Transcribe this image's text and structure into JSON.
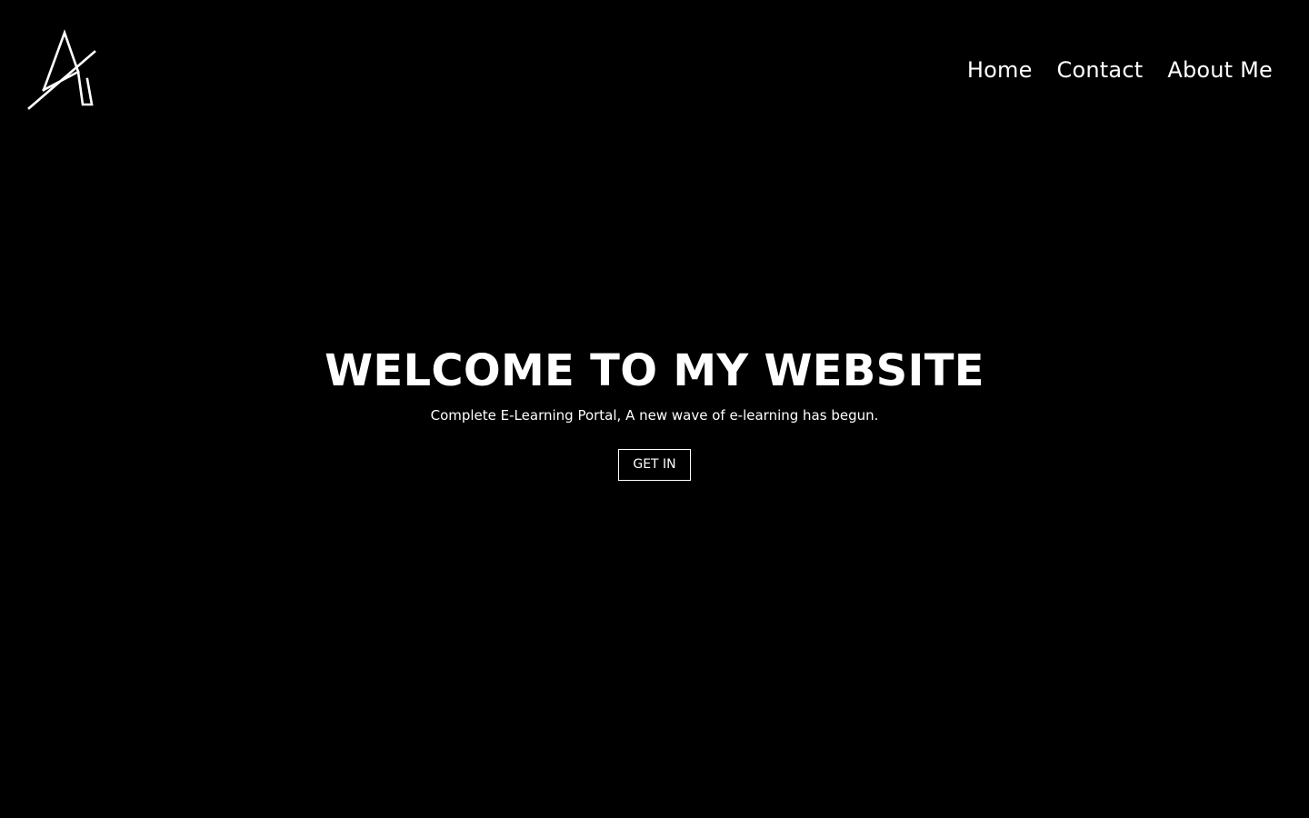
{
  "colors": {
    "background": "#000000",
    "foreground": "#ffffff"
  },
  "header": {
    "logo_icon": "stylized-a-logo-icon",
    "nav": [
      {
        "label": "Home"
      },
      {
        "label": "Contact"
      },
      {
        "label": "About Me"
      }
    ]
  },
  "hero": {
    "title": "WELCOME TO MY WEBSITE",
    "subtitle": "Complete E-Learning Portal, A new wave of e-learning has begun.",
    "button_label": "GET IN"
  }
}
